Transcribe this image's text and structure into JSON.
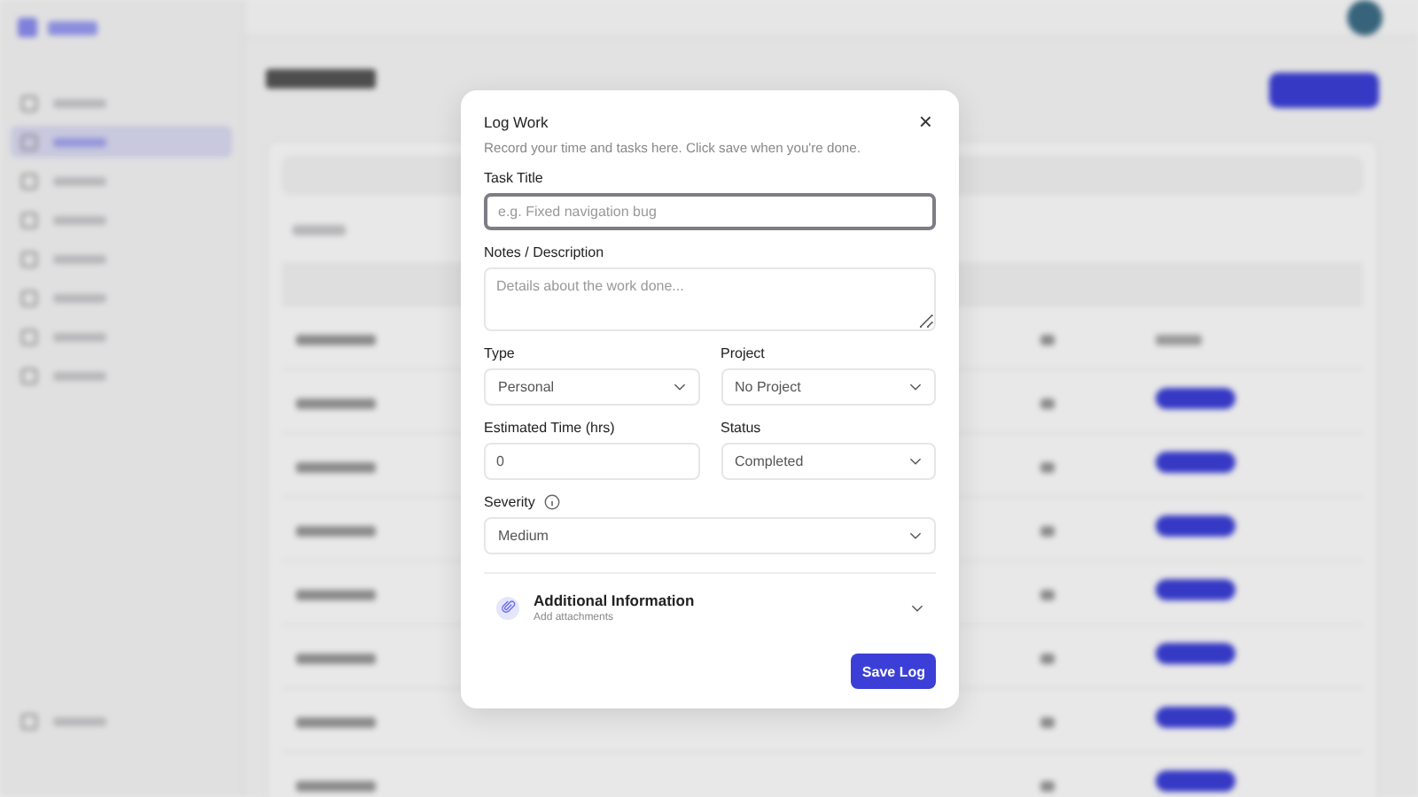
{
  "backdrop": {
    "nav": [
      {
        "selected": false
      },
      {
        "selected": true
      },
      {
        "selected": false
      },
      {
        "selected": false
      },
      {
        "selected": false
      },
      {
        "selected": false
      },
      {
        "selected": false
      },
      {
        "selected": false
      }
    ],
    "rows": [
      {
        "kind": "text"
      },
      {
        "kind": "badge"
      },
      {
        "kind": "badge"
      },
      {
        "kind": "badge"
      },
      {
        "kind": "badge"
      },
      {
        "kind": "badge"
      },
      {
        "kind": "badge"
      },
      {
        "kind": "badge"
      }
    ]
  },
  "dialog": {
    "title": "Log Work",
    "description": "Record your time and tasks here. Click save when you're done.",
    "close": "×",
    "rows": [
      [
        {
          "kind": "input",
          "label": "Task Title",
          "placeholder": "e.g. Fixed navigation bug",
          "focused": true
        }
      ],
      [
        {
          "kind": "textarea",
          "label": "Notes / Description",
          "placeholder": "Details about the work done...",
          "focused": false
        }
      ],
      [
        {
          "kind": "select",
          "label": "Type",
          "value": "Personal"
        },
        {
          "kind": "select",
          "label": "Project",
          "value": "No Project"
        }
      ],
      [
        {
          "kind": "input",
          "label": "Estimated Time (hrs)",
          "value": "0",
          "focused": false
        },
        {
          "kind": "select",
          "label": "Status",
          "value": "Completed"
        }
      ],
      [
        {
          "kind": "select",
          "label": "Severity",
          "value": "Medium",
          "info": true
        }
      ]
    ],
    "section": {
      "title": "Additional Information",
      "subtitle": "Add attachments",
      "expanded": false
    },
    "save": "Save Log"
  }
}
